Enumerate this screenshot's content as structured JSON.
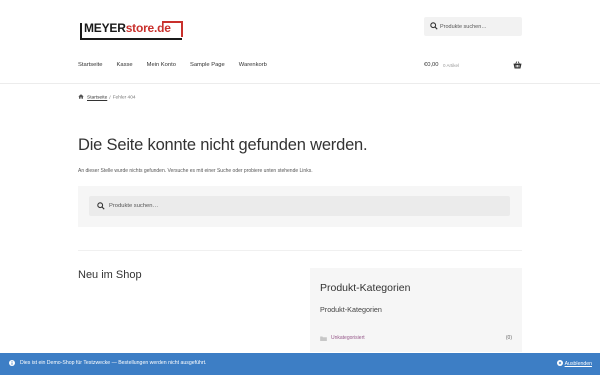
{
  "brand": {
    "logo_part1": "MEYER",
    "logo_part2": "store.de",
    "accent": "#c9302c",
    "ink": "#1a1a1a"
  },
  "header": {
    "search_placeholder": "Produkte suchen…",
    "nav": [
      "Startseite",
      "Kasse",
      "Mein Konto",
      "Sample Page",
      "Warenkorb"
    ],
    "cart": {
      "amount": "€0,00",
      "items": "0 Artikel",
      "icon": "basket-icon"
    }
  },
  "breadcrumb": {
    "home_icon": "home-icon",
    "home": "Startseite",
    "separator": "/",
    "current": "Fehler 404"
  },
  "main": {
    "title": "Die Seite konnte nicht gefunden werden.",
    "description": "An dieser Stelle wurde nichts gefunden. Versuche es mit einer Suche oder probiere unten stehende Links.",
    "search_placeholder": "Produkte suchen…"
  },
  "new_in_shop": {
    "heading": "Neu im Shop"
  },
  "categories_widget": {
    "heading": "Produkt-Kategorien",
    "subheading": "Produkt-Kategorien",
    "items": [
      {
        "label": "Unkategorisiert",
        "count": "(0)",
        "icon": "folder-icon"
      }
    ],
    "link_color": "#96588a"
  },
  "store_notice": {
    "message": "Dies ist ein Demo-Shop für Testzwecke — Bestellungen werden nicht ausgeführt.",
    "dismiss": "Ausblenden",
    "background": "#3d7ec5"
  }
}
